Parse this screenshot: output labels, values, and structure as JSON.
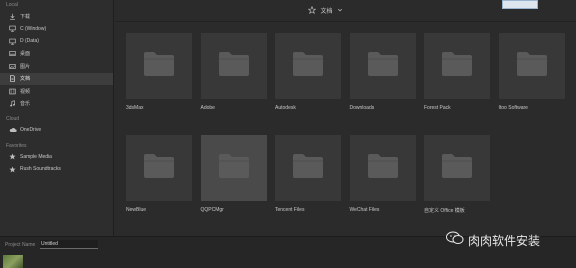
{
  "sidebar": {
    "local_title": "Local",
    "local_items": [
      {
        "icon": "download-icon",
        "label": "下载"
      },
      {
        "icon": "monitor-icon",
        "label": "C (Window)"
      },
      {
        "icon": "monitor-icon",
        "label": "D (Data)"
      },
      {
        "icon": "desktop-icon",
        "label": "桌面"
      },
      {
        "icon": "image-icon",
        "label": "图片"
      },
      {
        "icon": "document-icon",
        "label": "文档",
        "active": true
      },
      {
        "icon": "video-icon",
        "label": "视频"
      },
      {
        "icon": "music-icon",
        "label": "音乐"
      }
    ],
    "cloud_title": "Cloud",
    "cloud_items": [
      {
        "icon": "cloud-icon",
        "label": "OneDrive"
      }
    ],
    "favorites_title": "Favorites",
    "favorite_items": [
      {
        "icon": "star-icon",
        "label": "Sample Media"
      },
      {
        "icon": "star-icon",
        "label": "Rush Soundtracks"
      }
    ]
  },
  "header": {
    "location": "文档"
  },
  "folders": [
    {
      "label": "3dsMax"
    },
    {
      "label": "Adobe"
    },
    {
      "label": "Autodesk"
    },
    {
      "label": "Downloads"
    },
    {
      "label": "Forest Pack"
    },
    {
      "label": "Itoo Software"
    },
    {
      "label": "NewBlue"
    },
    {
      "label": "QQPCMgr",
      "selected": true
    },
    {
      "label": "Tencent Files"
    },
    {
      "label": "WeChat Files"
    },
    {
      "label": "自定义 Office 模板"
    }
  ],
  "bottom": {
    "project_name_label": "Project Name",
    "project_name_value": "Untitled"
  },
  "watermark": {
    "text": "肉肉软件安装"
  },
  "colors": {
    "background": "#2b2b2b",
    "tile": "#383838",
    "tile_selected": "#4a4a4a",
    "folder_icon": "#5a5a5a"
  }
}
